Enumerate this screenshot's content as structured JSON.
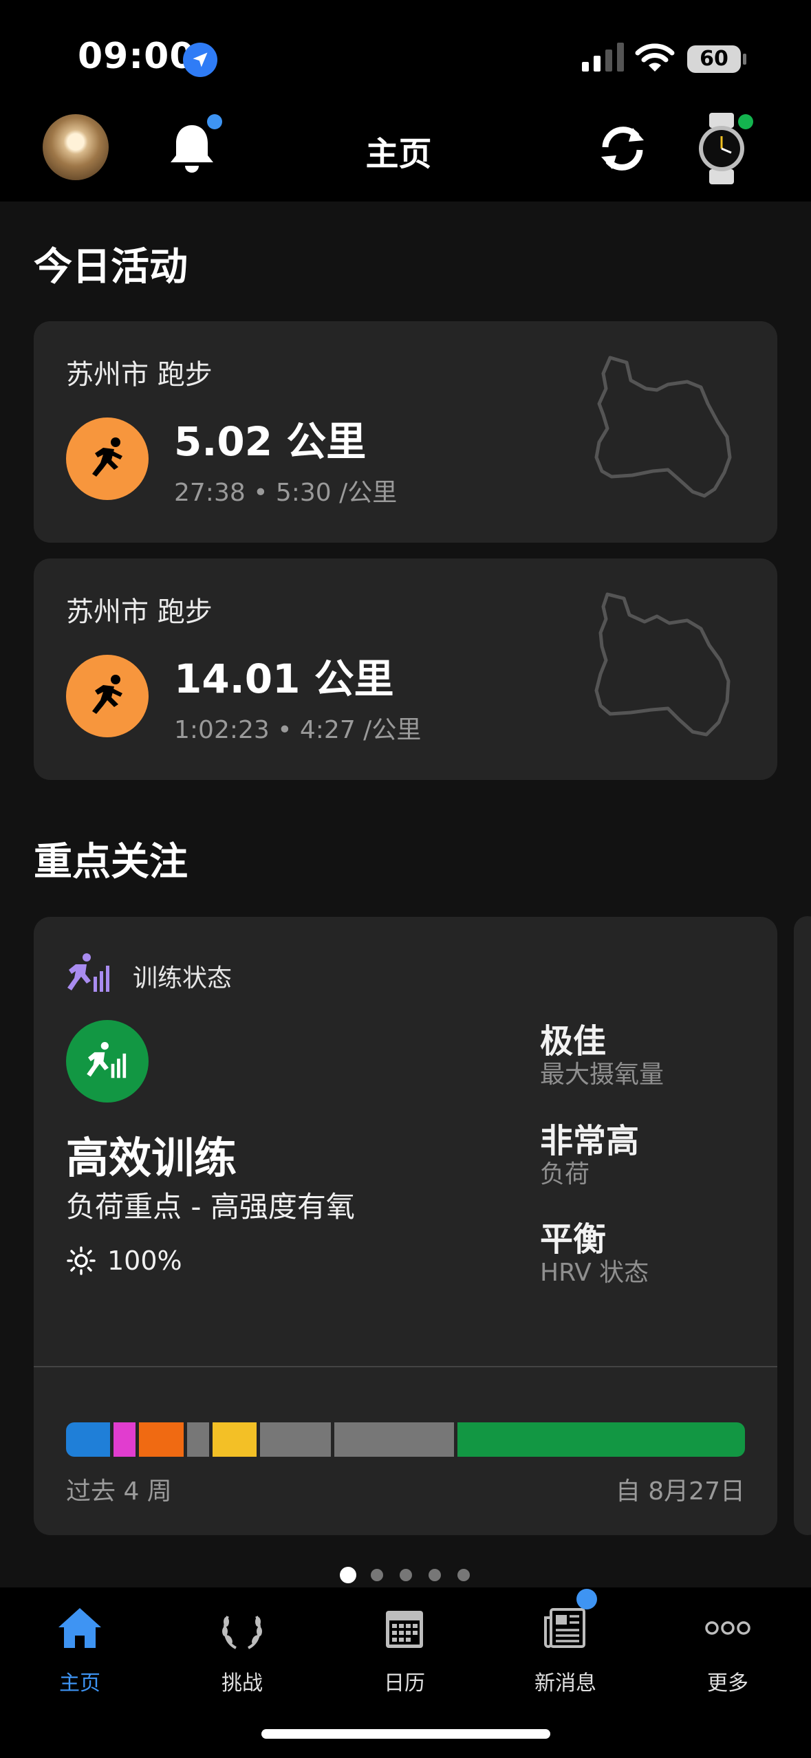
{
  "status_bar": {
    "time": "09:00",
    "battery": "60"
  },
  "header": {
    "title": "主页"
  },
  "today": {
    "title": "今日活动",
    "activities": [
      {
        "place": "苏州市 跑步",
        "distance": "5.02 公里",
        "stats": "27:38 • 5:30 /公里"
      },
      {
        "place": "苏州市 跑步",
        "distance": "14.01 公里",
        "stats": "1:02:23 • 4:27 /公里"
      }
    ]
  },
  "focus": {
    "title": "重点关注",
    "card": {
      "label": "训练状态",
      "status": "高效训练",
      "load_focus": "负荷重点 - 高强度有氧",
      "percent": "100%",
      "metrics": [
        {
          "value": "极佳",
          "name": "最大摄氧量"
        },
        {
          "value": "非常高",
          "name": "负荷"
        },
        {
          "value": "平衡",
          "name": "HRV 状态"
        }
      ],
      "history_left": "过去 4 周",
      "history_right": "自 8月27日",
      "history_segments": [
        {
          "color": "#1f7fd8",
          "weight": 5
        },
        {
          "color": "#e13dcf",
          "weight": 2.5
        },
        {
          "color": "#f06a12",
          "weight": 5
        },
        {
          "color": "#777777",
          "weight": 2.5
        },
        {
          "color": "#f3c026",
          "weight": 5
        },
        {
          "color": "#777777",
          "weight": 8
        },
        {
          "color": "#777777",
          "weight": 13.5
        },
        {
          "color": "#129743",
          "weight": 32.5
        }
      ]
    },
    "page_count": 5,
    "page_active": 0
  },
  "tabbar": {
    "items": [
      {
        "label": "主页",
        "icon": "home-icon",
        "active": true
      },
      {
        "label": "挑战",
        "icon": "laurel-icon"
      },
      {
        "label": "日历",
        "icon": "calendar-icon"
      },
      {
        "label": "新消息",
        "icon": "news-icon",
        "badge": true
      },
      {
        "label": "更多",
        "icon": "more-icon"
      }
    ]
  },
  "colors": {
    "accent": "#3e94f3",
    "activity": "#f7963d",
    "training": "#129743",
    "card": "#252525"
  }
}
